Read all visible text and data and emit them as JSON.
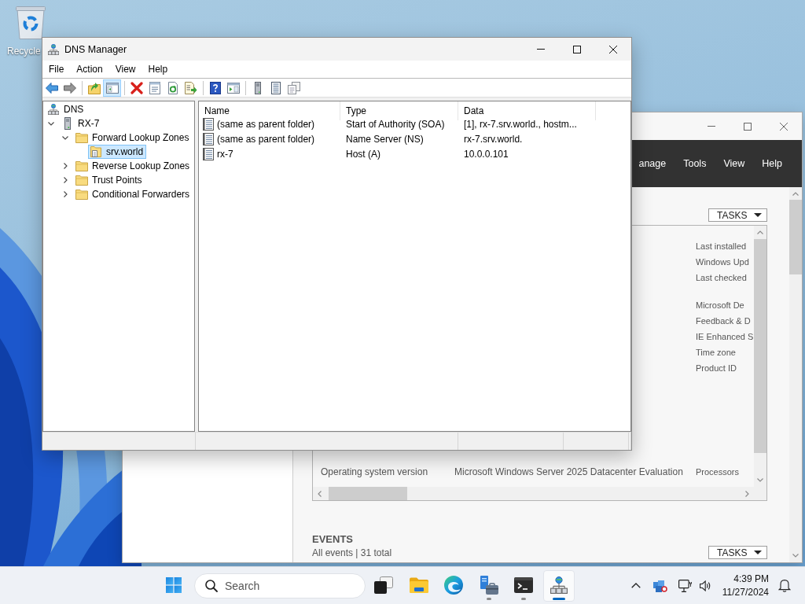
{
  "desktop": {
    "shortcuts": [
      {
        "label": "Recycle"
      }
    ]
  },
  "server_manager": {
    "menu": [
      "anage",
      "Tools",
      "View",
      "Help"
    ],
    "properties": {
      "tasks": "TASKS",
      "column_3": {
        "groups": [
          [
            "Last installed",
            "Windows Upd",
            "Last checked"
          ],
          [
            "Microsoft De",
            "Feedback & D",
            "IE Enhanced S",
            "Time zone",
            "Product ID"
          ]
        ]
      },
      "rows": [
        [
          "Operating system version",
          "Microsoft Windows Server 2025 Datacenter Evaluation",
          "Processors"
        ]
      ]
    },
    "events": {
      "title": "EVENTS",
      "summary": "All events | 31 total",
      "tasks": "TASKS"
    }
  },
  "dns_manager": {
    "title": "DNS Manager",
    "menu": [
      "File",
      "Action",
      "View",
      "Help"
    ],
    "toolbar": [
      [
        {
          "kind": "back",
          "pressed": false,
          "disabled": false
        },
        {
          "kind": "forward",
          "pressed": false,
          "disabled": true
        }
      ],
      [
        {
          "kind": "up",
          "pressed": false,
          "disabled": false
        },
        {
          "kind": "console-tree",
          "pressed": true,
          "disabled": false
        }
      ],
      [
        {
          "kind": "delete",
          "pressed": false,
          "disabled": false
        },
        {
          "kind": "properties",
          "pressed": false,
          "disabled": false
        },
        {
          "kind": "refresh",
          "pressed": false,
          "disabled": false
        },
        {
          "kind": "export",
          "pressed": false,
          "disabled": false
        }
      ],
      [
        {
          "kind": "help",
          "pressed": false,
          "disabled": false
        },
        {
          "kind": "action-pane",
          "pressed": false,
          "disabled": false
        }
      ],
      [
        {
          "kind": "server",
          "pressed": false,
          "disabled": false
        },
        {
          "kind": "list",
          "pressed": false,
          "disabled": false
        },
        {
          "kind": "copy",
          "pressed": false,
          "disabled": false
        }
      ]
    ],
    "tree": [
      {
        "label": "DNS",
        "kind": "dns",
        "selected": false,
        "children": [
          {
            "label": "RX-7",
            "kind": "server",
            "expanded": true,
            "selected": false,
            "children": [
              {
                "label": "Forward Lookup Zones",
                "kind": "folder",
                "expanded": true,
                "selected": false,
                "children": [
                  {
                    "label": "srv.world",
                    "kind": "zone",
                    "selected": true
                  }
                ]
              },
              {
                "label": "Reverse Lookup Zones",
                "kind": "folder",
                "expanded": false,
                "selected": false
              },
              {
                "label": "Trust Points",
                "kind": "folder",
                "expanded": false,
                "selected": false
              },
              {
                "label": "Conditional Forwarders",
                "kind": "folder",
                "expanded": false,
                "selected": false
              }
            ]
          }
        ]
      }
    ],
    "list": {
      "columns": [
        "Name",
        "Type",
        "Data"
      ],
      "rows": [
        [
          "(same as parent folder)",
          "Start of Authority (SOA)",
          "[1], rx-7.srv.world., hostm..."
        ],
        [
          "(same as parent folder)",
          "Name Server (NS)",
          "rx-7.srv.world."
        ],
        [
          "rx-7",
          "Host (A)",
          "10.0.0.101"
        ]
      ]
    }
  },
  "taskbar": {
    "search": {
      "placeholder": "Search"
    },
    "apps": [
      {
        "kind": "task-view",
        "running": false,
        "active": false
      },
      {
        "kind": "file-explorer",
        "running": false,
        "active": false
      },
      {
        "kind": "browser",
        "running": false,
        "active": false
      },
      {
        "kind": "server-manager",
        "running": true,
        "active": false
      },
      {
        "kind": "terminal",
        "running": true,
        "active": false
      },
      {
        "kind": "dns",
        "running": true,
        "active": true
      }
    ],
    "clock": {
      "time": "4:39 PM",
      "date": "11/27/2024"
    }
  }
}
